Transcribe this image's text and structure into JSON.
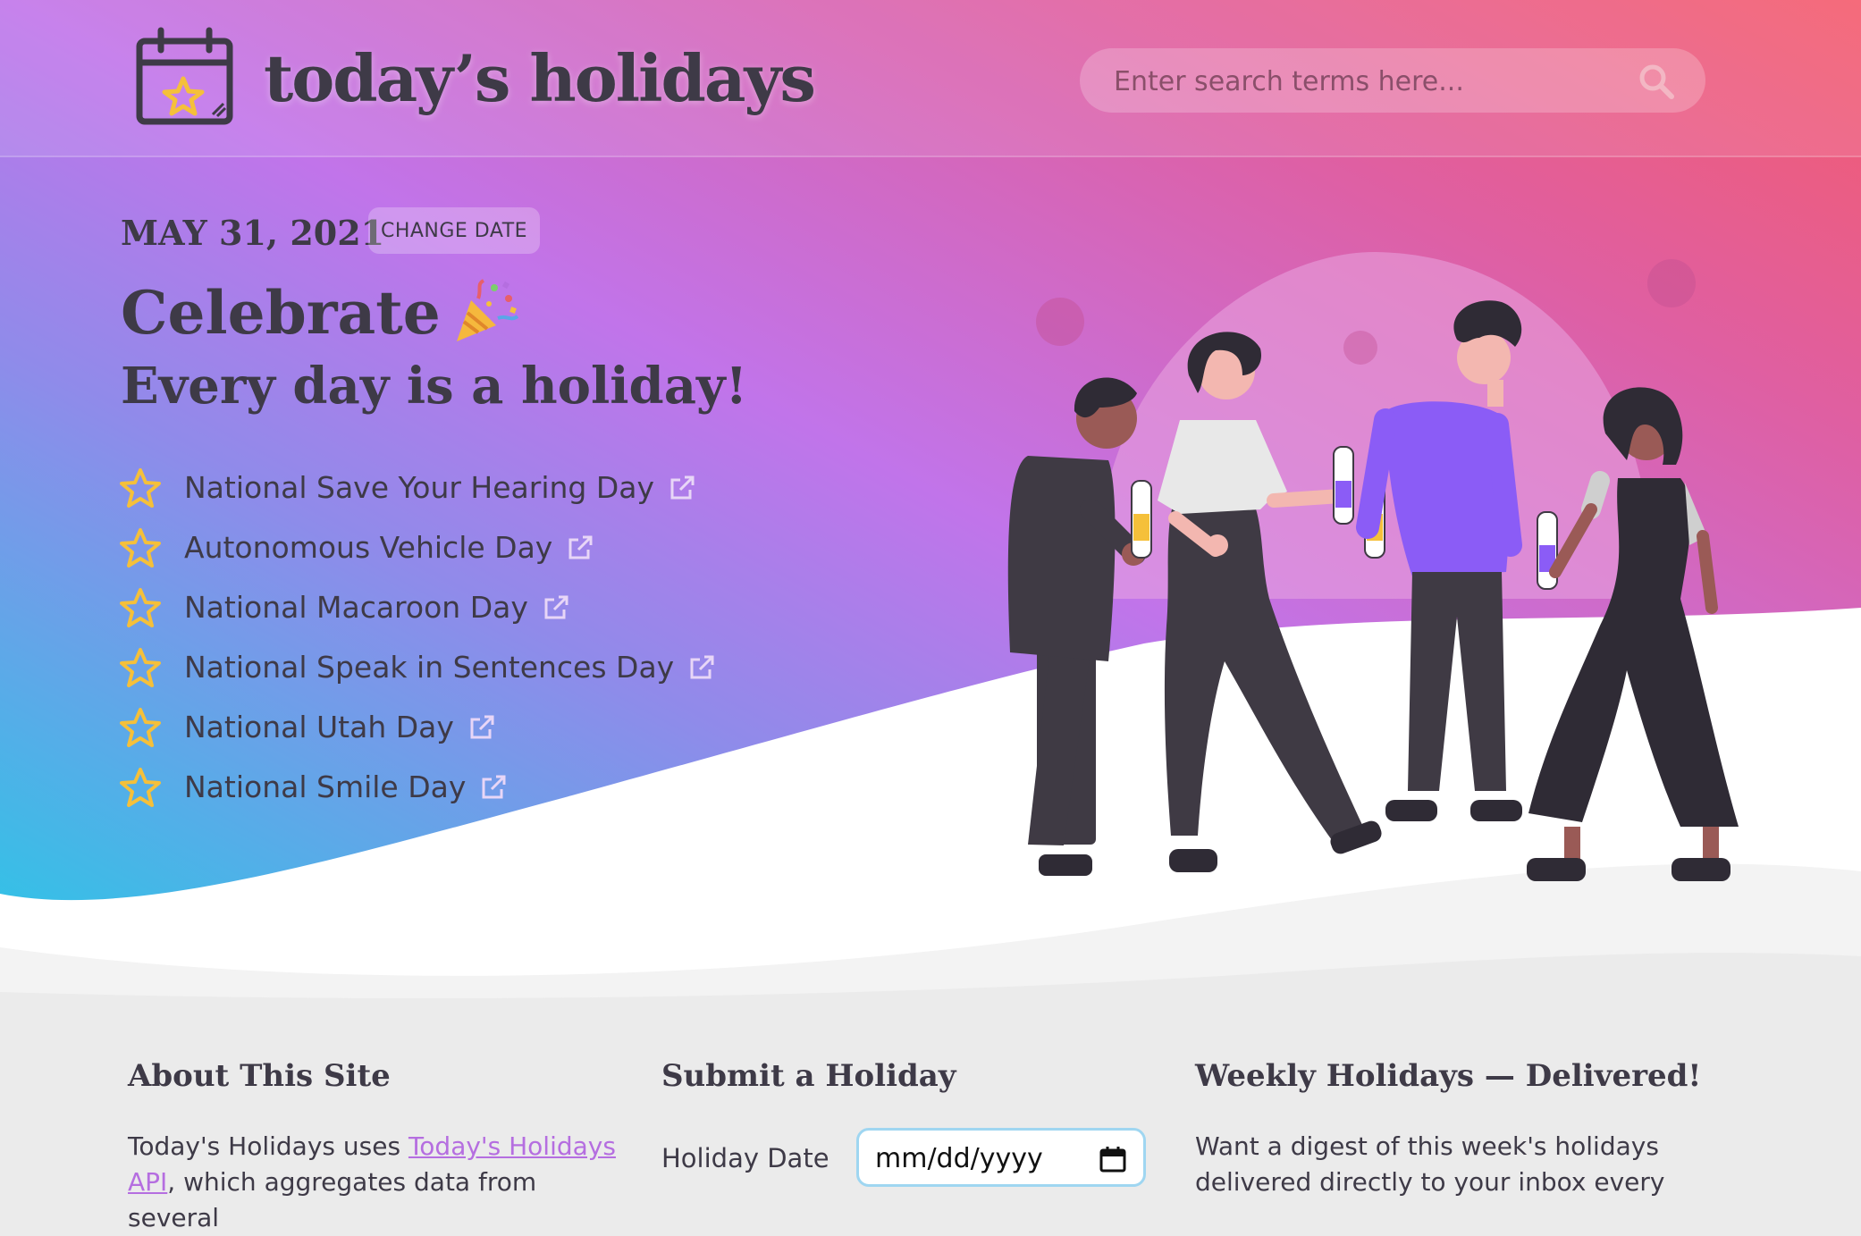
{
  "header": {
    "site_title": "today’s holidays",
    "search_placeholder": "Enter search terms here...",
    "logo_icon": "calendar-star-icon",
    "search_icon": "magnifier-icon"
  },
  "hero": {
    "date": "MAY 31, 2021",
    "change_date_label": "CHANGE DATE",
    "headline_1": "Celebrate",
    "headline_emoji": "party-popper-icon",
    "headline_2": "Every day is a holiday!",
    "holidays": [
      {
        "name": "National Save Your Hearing Day"
      },
      {
        "name": "Autonomous Vehicle Day"
      },
      {
        "name": "National Macaroon Day"
      },
      {
        "name": "National Speak in Sentences Day"
      },
      {
        "name": "National Utah Day"
      },
      {
        "name": "National Smile Day"
      }
    ],
    "illustration": "people-celebrating-with-bottles"
  },
  "about": {
    "title": "About This Site",
    "text_prefix": "Today's Holidays uses ",
    "link_line1": "Today's Holidays",
    "link_line2": "API",
    "text_suffix": ", which aggregates data from several"
  },
  "submit": {
    "title": "Submit a Holiday",
    "date_label": "Holiday Date",
    "date_placeholder": "mm/dd/yyyy"
  },
  "weekly": {
    "title": "Weekly Holidays — Delivered!",
    "text_line1": "Want a digest of this week's holidays",
    "text_line2": "delivered directly to your inbox every"
  },
  "colors": {
    "text_dark": "#3e3a47",
    "star_yellow": "#f5c03a",
    "link_purple": "#b56ee0",
    "gradient_top_right": "#f45b6c",
    "gradient_mid": "#c174ea",
    "gradient_bottom_left": "#28c8e6"
  }
}
